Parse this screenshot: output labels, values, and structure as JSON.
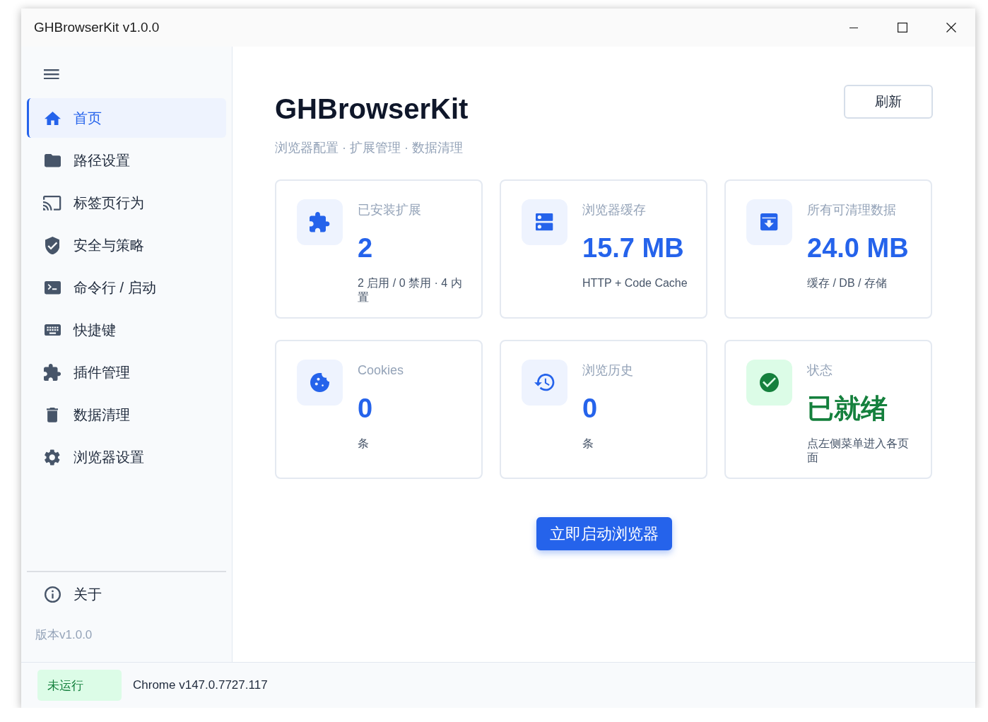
{
  "window": {
    "title": "GHBrowserKit v1.0.0"
  },
  "sidebar": {
    "items": [
      {
        "label": "首页",
        "selected": true
      },
      {
        "label": "路径设置",
        "selected": false
      },
      {
        "label": "标签页行为",
        "selected": false
      },
      {
        "label": "安全与策略",
        "selected": false
      },
      {
        "label": "命令行 / 启动",
        "selected": false
      },
      {
        "label": "快捷键",
        "selected": false
      },
      {
        "label": "插件管理",
        "selected": false
      },
      {
        "label": "数据清理",
        "selected": false
      },
      {
        "label": "浏览器设置",
        "selected": false
      }
    ],
    "footer_items": [
      {
        "label": "关于",
        "selected": false
      }
    ],
    "version": "版本v1.0.0"
  },
  "header": {
    "title": "GHBrowserKit",
    "subtitle": "浏览器配置 · 扩展管理 · 数据清理",
    "refresh_button": "刷新"
  },
  "cards": [
    {
      "kind": "metric",
      "label": "已安装扩展",
      "value": "2",
      "detail": "2 启用 / 0 禁用 · 4 内置"
    },
    {
      "kind": "metric",
      "label": "浏览器缓存",
      "value": "15.7 MB",
      "detail": "HTTP + Code Cache"
    },
    {
      "kind": "metric",
      "label": "所有可清理数据",
      "value": "24.0 MB",
      "detail": "缓存 / DB / 存储"
    },
    {
      "kind": "metric",
      "label": "Cookies",
      "value": "0",
      "detail": "条"
    },
    {
      "kind": "metric",
      "label": "浏览历史",
      "value": "0",
      "detail": "条"
    },
    {
      "kind": "status",
      "label": "状态",
      "value": "已就绪",
      "detail": "点左侧菜单进入各页面"
    }
  ],
  "launch_button": "立即启动浏览器",
  "status_bar": {
    "badge": "未运行",
    "browser_version": "Chrome v147.0.7727.117"
  }
}
